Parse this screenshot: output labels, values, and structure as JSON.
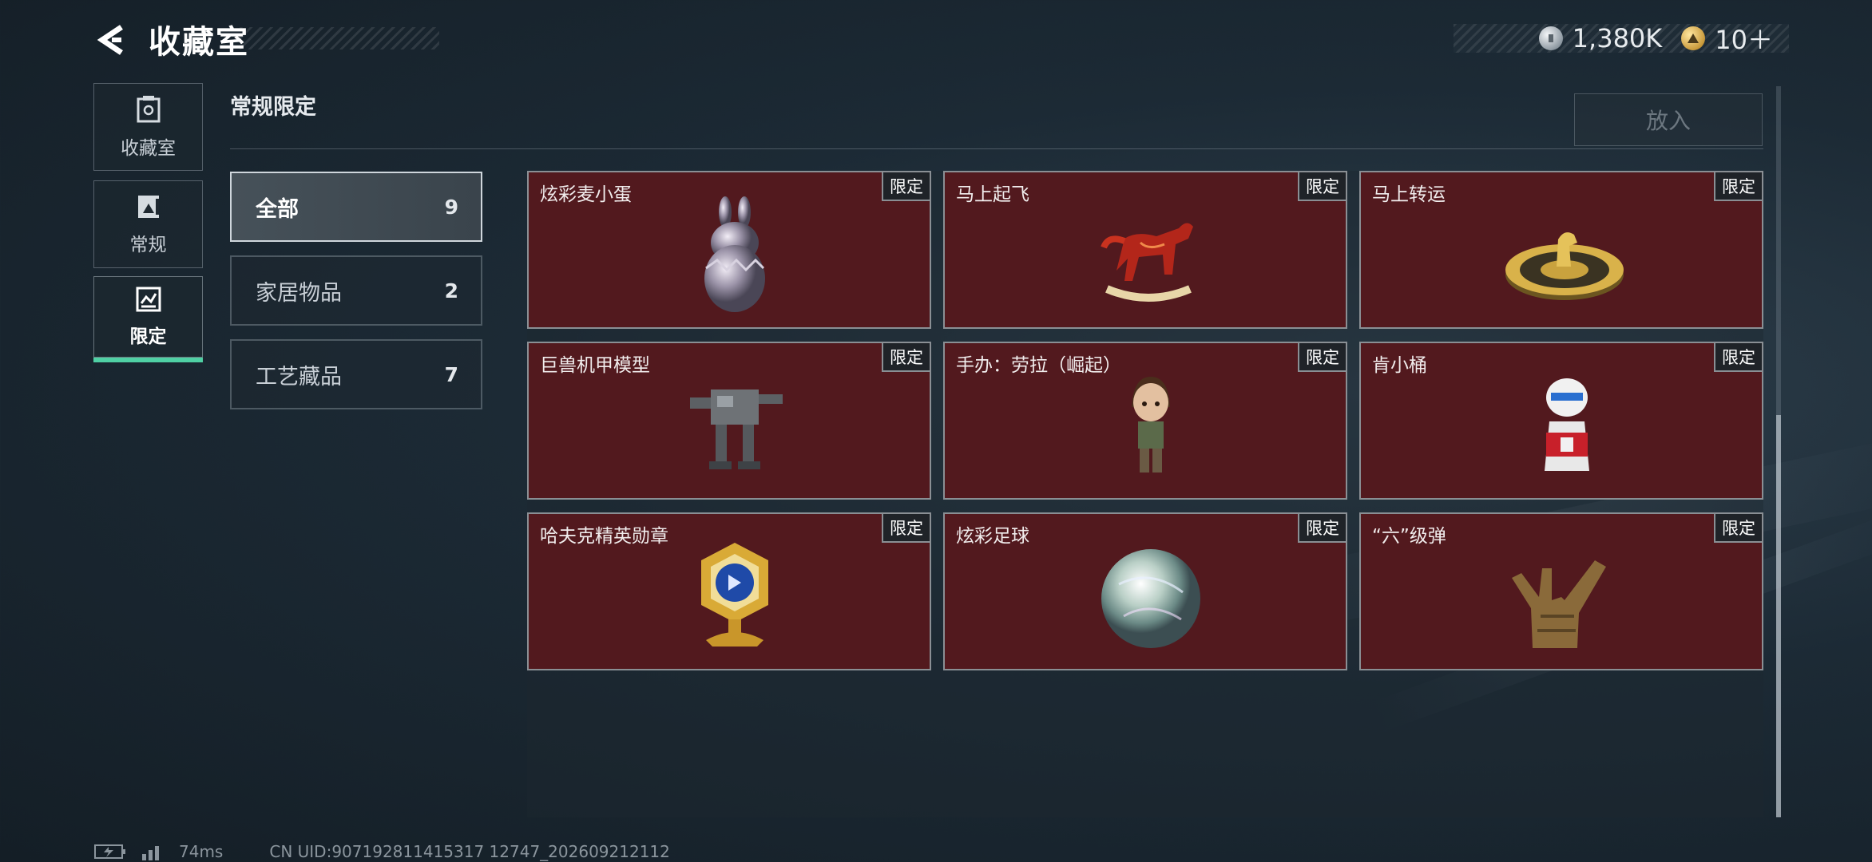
{
  "header": {
    "title": "收藏室",
    "currencies": [
      {
        "icon": "silver-coin-icon",
        "value": "1,380K"
      },
      {
        "icon": "gold-triangle-coin-icon",
        "value": "10＋"
      }
    ]
  },
  "nav": {
    "items": [
      {
        "label": "收藏室",
        "icon": "collection-room-icon",
        "active": false
      },
      {
        "label": "常规",
        "icon": "regular-album-icon",
        "active": false
      },
      {
        "label": "限定",
        "icon": "limited-frame-icon",
        "active": true
      }
    ]
  },
  "content": {
    "section_title": "常规限定",
    "place_button": "放入"
  },
  "filters": [
    {
      "label": "全部",
      "count": "9",
      "active": true
    },
    {
      "label": "家居物品",
      "count": "2",
      "active": false
    },
    {
      "label": "工艺藏品",
      "count": "7",
      "active": false
    }
  ],
  "items": [
    {
      "name": "炫彩麦小蛋",
      "badge": "限定",
      "art": "pearl-bunny-egg"
    },
    {
      "name": "马上起飞",
      "badge": "限定",
      "art": "red-rocking-horse"
    },
    {
      "name": "马上转运",
      "badge": "限定",
      "art": "golden-horse-wheel"
    },
    {
      "name": "巨兽机甲模型",
      "badge": "限定",
      "art": "mech-model"
    },
    {
      "name": "手办：劳拉（崛起）",
      "badge": "限定",
      "art": "lara-figure"
    },
    {
      "name": "肯小桶",
      "badge": "限定",
      "art": "colonel-bucket-figure"
    },
    {
      "name": "哈夫克精英勋章",
      "badge": "限定",
      "art": "elite-medal"
    },
    {
      "name": "炫彩足球",
      "badge": "限定",
      "art": "iridescent-ball"
    },
    {
      "name": "“六”级弹",
      "badge": "限定",
      "art": "golden-hand-sculpture"
    }
  ],
  "footer": {
    "ping": "74ms",
    "uid": "CN UID:907192811415317 12747_202609212112"
  },
  "colors": {
    "card_bg": "#52191e",
    "accent": "#4fd0a4",
    "badge_bg": "#1f2328"
  }
}
